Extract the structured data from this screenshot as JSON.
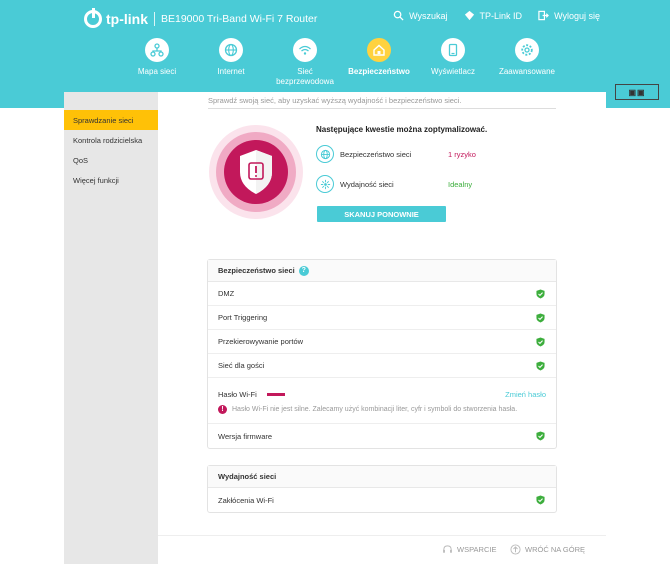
{
  "header": {
    "brand": "tp-link",
    "model": "BE19000 Tri-Band Wi-Fi 7 Router",
    "links": [
      {
        "label": "Wyszukaj",
        "icon": "search-icon"
      },
      {
        "label": "TP-Link ID",
        "icon": "user-icon"
      },
      {
        "label": "Wyloguj się",
        "icon": "logout-icon"
      }
    ],
    "colors": {
      "header": "#4acbd6",
      "active": "#ffd23f",
      "sidebar_active": "#ffc107",
      "warn": "#c2185b",
      "ok": "#3dae3d"
    }
  },
  "nav": [
    {
      "label": "Mapa sieci",
      "icon": "network-map-icon"
    },
    {
      "label": "Internet",
      "icon": "globe-icon"
    },
    {
      "label": "Sieć bezprzewodowa",
      "icon": "wifi-icon"
    },
    {
      "label": "Bezpieczeństwo",
      "icon": "home-shield-icon",
      "active": true
    },
    {
      "label": "Wyświetlacz",
      "icon": "display-icon"
    },
    {
      "label": "Zaawansowane",
      "icon": "gear-icon"
    }
  ],
  "sidebar": {
    "items": [
      {
        "label": "Sprawdzanie sieci",
        "active": true
      },
      {
        "label": "Kontrola rodzicielska"
      },
      {
        "label": "QoS"
      },
      {
        "label": "Więcej funkcji"
      }
    ]
  },
  "main": {
    "intro": "Sprawdź swoją sieć, aby uzyskać wyższą wydajność i bezpieczeństwo sieci.",
    "optimize_title": "Następujące kwestie można zoptymalizować.",
    "items": [
      {
        "label": "Bezpieczeństwo sieci",
        "value": "1 ryzyko",
        "status": "warn"
      },
      {
        "label": "Wydajność sieci",
        "value": "Idealny",
        "status": "ok"
      }
    ],
    "scan_button": "SKANUJ PONOWNIE"
  },
  "security_card": {
    "title": "Bezpieczeństwo sieci",
    "help": "?",
    "rows": [
      "DMZ",
      "Port Triggering",
      "Przekierowywanie portów",
      "Sieć dla gości"
    ],
    "password": {
      "label": "Hasło Wi-Fi",
      "link": "Zmień hasło",
      "warning": "Hasło Wi-Fi nie jest silne. Zalecamy użyć kombinacji liter, cyfr i symboli do stworzenia hasła.",
      "warn_mark": "!"
    },
    "firmware": "Wersja firmware"
  },
  "performance_card": {
    "title": "Wydajność sieci",
    "rows": [
      "Zakłócenia Wi-Fi"
    ]
  },
  "footer": {
    "support": "WSPARCIE",
    "top": "WRÓĆ NA GÓRĘ"
  }
}
